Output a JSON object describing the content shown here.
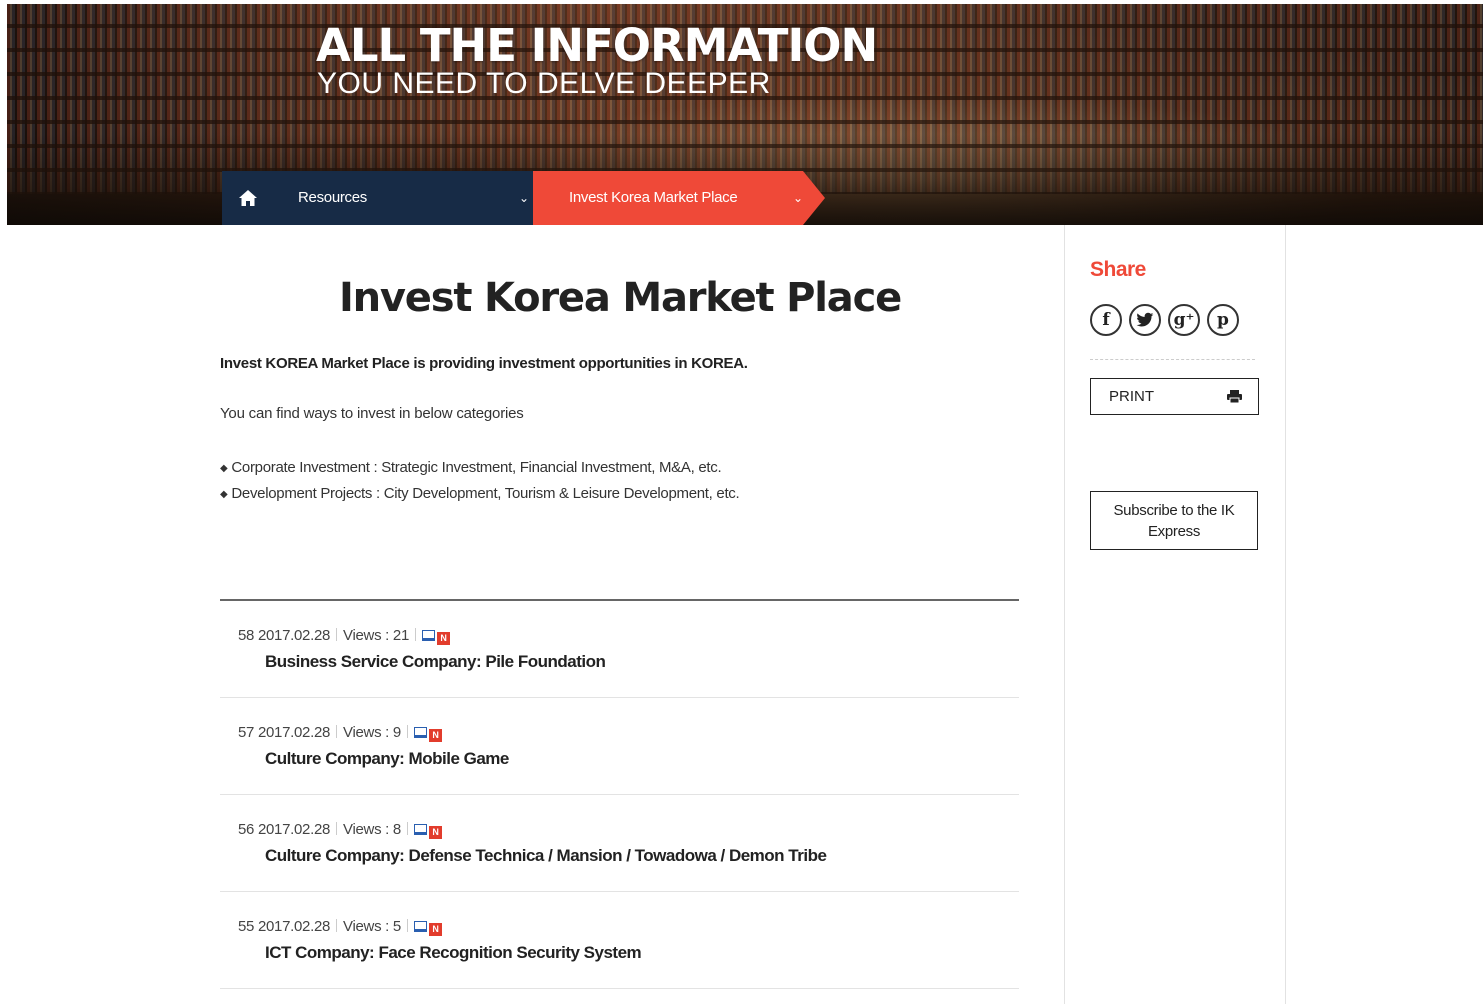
{
  "hero": {
    "title": "ALL THE INFORMATION",
    "subtitle": "YOU NEED TO DELVE DEEPER"
  },
  "breadcrumb": {
    "home_icon": "home-icon",
    "items": [
      {
        "label": "Resources",
        "icon": "chevron-down-icon",
        "chevron": "⌄"
      },
      {
        "label": "Invest Korea Market Place",
        "icon": "chevron-down-icon",
        "chevron": "⌄"
      }
    ]
  },
  "main": {
    "title": "Invest Korea Market Place",
    "intro": "Invest KOREA Market Place is providing investment opportunities in KOREA.",
    "intro2": "You can find ways to invest in below categories",
    "bullet": "◆",
    "categories": [
      "Corporate Investment : Strategic Investment, Financial Investment, M&A, etc.",
      "Development Projects : City Development, Tourism & Leisure Development, etc."
    ]
  },
  "list": {
    "views_label": "Views :",
    "new_badge": "N",
    "items": [
      {
        "number": "58",
        "date": "2017.02.28",
        "views": "21",
        "title": "Business Service Company: Pile Foundation"
      },
      {
        "number": "57",
        "date": "2017.02.28",
        "views": "9",
        "title": "Culture Company: Mobile Game"
      },
      {
        "number": "56",
        "date": "2017.02.28",
        "views": "8",
        "title": "Culture Company: Defense Technica / Mansion / Towadowa / Demon Tribe"
      },
      {
        "number": "55",
        "date": "2017.02.28",
        "views": "5",
        "title": "ICT Company: Face Recognition Security System"
      }
    ]
  },
  "sidebar": {
    "share_title": "Share",
    "share_icons": [
      {
        "name": "facebook-icon",
        "glyph": "f"
      },
      {
        "name": "twitter-icon",
        "glyph": "t"
      },
      {
        "name": "google-plus-icon",
        "glyph": "g⁺"
      },
      {
        "name": "pinterest-icon",
        "glyph": "p"
      }
    ],
    "print_label": "PRINT",
    "subscribe_label": "Subscribe to the IK Express"
  },
  "colors": {
    "accent": "#ef4938",
    "navy": "#172b46"
  }
}
